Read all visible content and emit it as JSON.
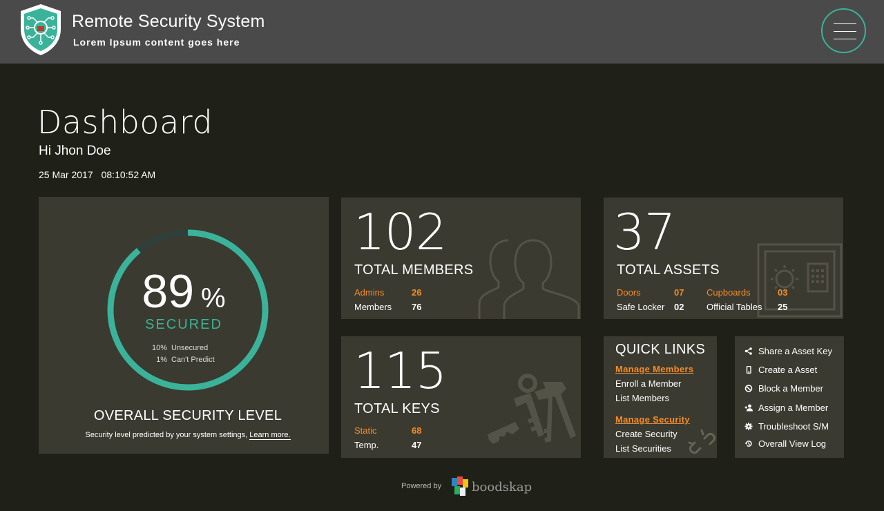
{
  "header": {
    "title": "Remote Security System",
    "subtitle": "Lorem Ipsum content goes here",
    "logo_icon": "shield-circuit-icon",
    "menu_icon": "hamburger-menu-icon"
  },
  "page": {
    "title": "Dashboard",
    "greeting": "Hi Jhon Doe",
    "date": "25 Mar 2017",
    "time": "08:10:52 AM"
  },
  "security": {
    "percent": "89",
    "percent_unit": "%",
    "percent_value": 89,
    "status": "SECURED",
    "stats": [
      {
        "value": "10%",
        "label": "Unsecured"
      },
      {
        "value": "1%",
        "label": "Can't Predict"
      }
    ],
    "title": "OVERALL SECURITY LEVEL",
    "note": "Security level predicted by your system settings,",
    "learn_more": "Learn more."
  },
  "members": {
    "count": "102",
    "label": "TOTAL MEMBERS",
    "rows": [
      {
        "label": "Admins",
        "value": "26"
      },
      {
        "label": "Members",
        "value": "76"
      }
    ],
    "icon": "users-icon"
  },
  "keys": {
    "count": "115",
    "label": "TOTAL KEYS",
    "rows": [
      {
        "label": "Static",
        "value": "68"
      },
      {
        "label": "Temp.",
        "value": "47"
      }
    ],
    "icon": "keys-icon"
  },
  "assets": {
    "count": "37",
    "label": "TOTAL ASSETS",
    "rows": [
      {
        "label": "Doors",
        "value": "07"
      },
      {
        "label": "Safe Locker",
        "value": "02"
      },
      {
        "label": "Cupboards",
        "value": "03"
      },
      {
        "label": "Official Tables",
        "value": "25"
      }
    ],
    "icon": "safe-icon"
  },
  "quick_links": {
    "title": "QUICK LINKS",
    "groups": [
      {
        "head": "Manage  Members",
        "items": [
          "Enroll a Member",
          "List Members"
        ]
      },
      {
        "head": "Manage  Security",
        "items": [
          "Create Security",
          "List Securities"
        ]
      }
    ],
    "icon": "link-icon"
  },
  "actions": [
    {
      "icon": "share-icon",
      "label": "Share a  Asset Key"
    },
    {
      "icon": "mobile-icon",
      "label": "Create a Asset"
    },
    {
      "icon": "block-icon",
      "label": "Block a Member"
    },
    {
      "icon": "add-user-icon",
      "label": "Assign a Member"
    },
    {
      "icon": "gear-icon",
      "label": "Troubleshoot S/M"
    },
    {
      "icon": "history-icon",
      "label": "Overall View Log"
    }
  ],
  "footer": {
    "powered_by": "Powered by",
    "brand": "boodskap"
  },
  "colors": {
    "accent": "#3ab39a",
    "orange": "#f28c28",
    "background": "#1f2017",
    "card": "#3b3a30",
    "header": "#4a4a4a"
  }
}
